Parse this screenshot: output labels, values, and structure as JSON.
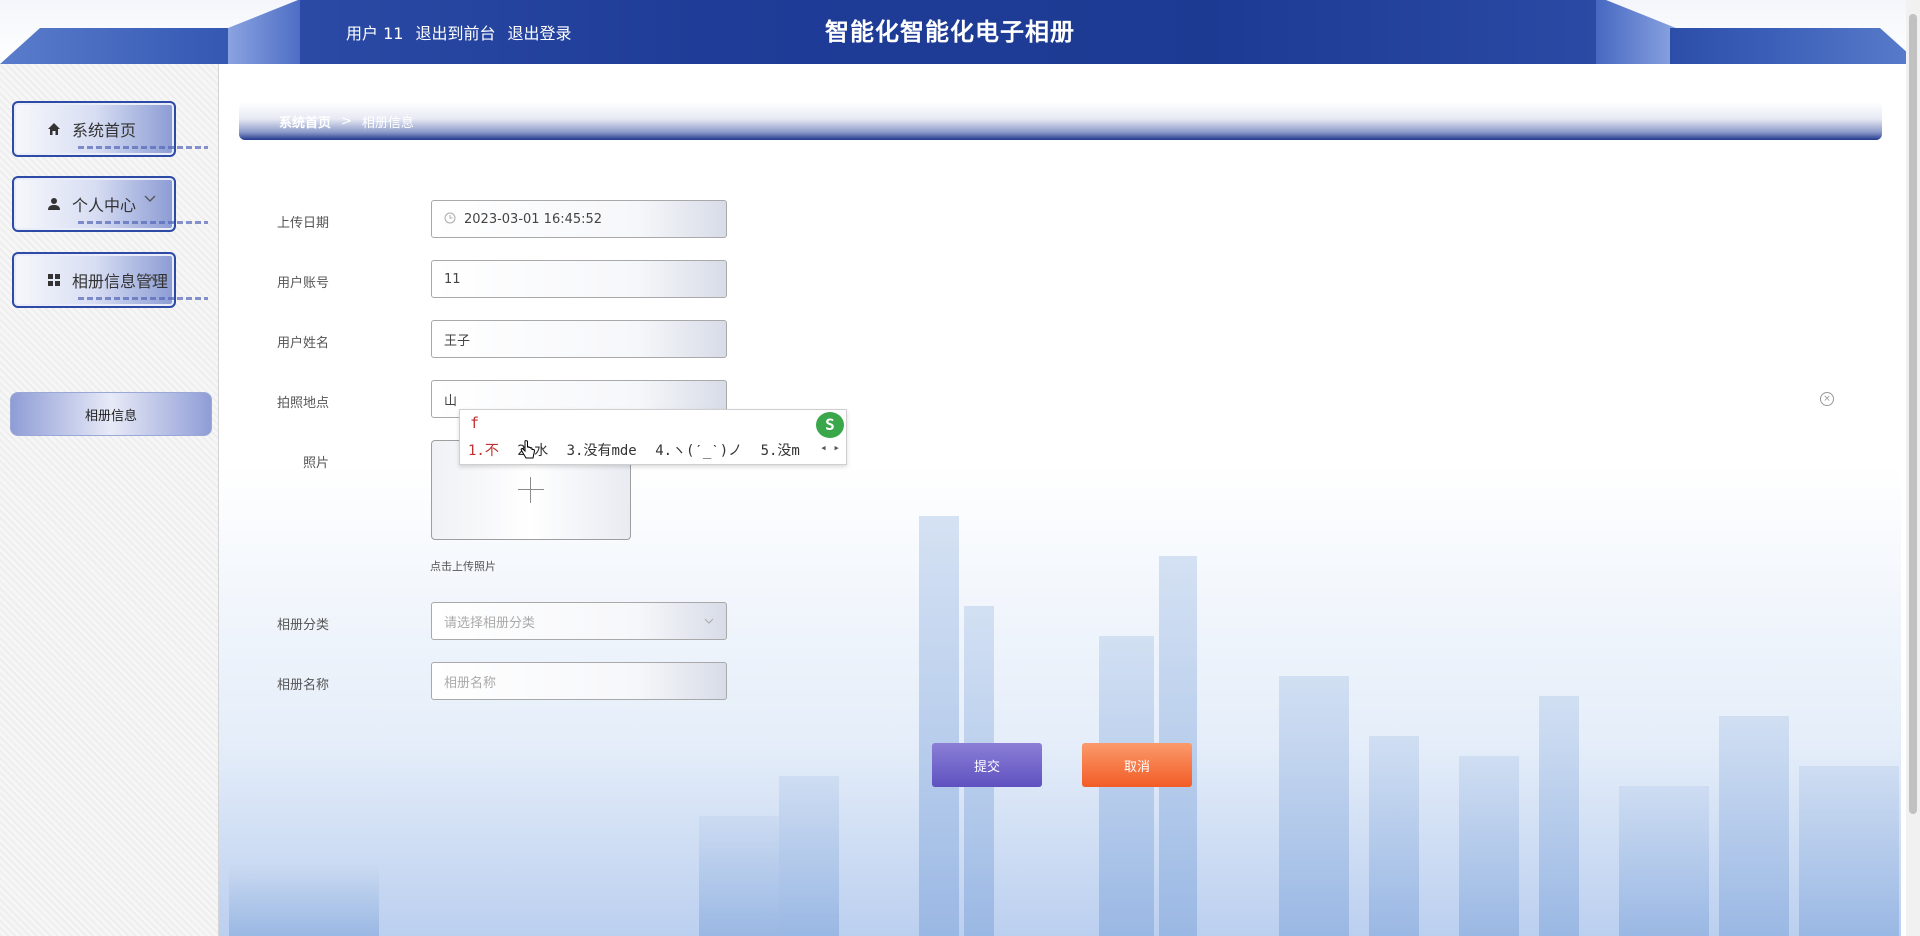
{
  "header": {
    "user_label": "用户 11",
    "link_front": "退出到前台",
    "link_logout": "退出登录",
    "app_title": "智能化智能化电子相册"
  },
  "sidebar": {
    "items": [
      {
        "label": "系统首页",
        "icon": "home-icon"
      },
      {
        "label": "个人中心",
        "icon": "user-icon",
        "chevron": "chevron-down-icon"
      },
      {
        "label": "相册信息管理",
        "icon": "grid-icon",
        "chevron": "chevron-up-icon"
      }
    ],
    "sub_item": "相册信息"
  },
  "breadcrumb": {
    "home": "系统首页",
    "sep": ">",
    "current": "相册信息"
  },
  "form": {
    "upload_date": {
      "label": "上传日期",
      "value": "2023-03-01 16:45:52"
    },
    "account": {
      "label": "用户账号",
      "value": "11"
    },
    "name": {
      "label": "用户姓名",
      "value": "王子"
    },
    "location": {
      "label": "拍照地点",
      "value": "山"
    },
    "photo": {
      "label": "照片",
      "hint": "点击上传照片"
    },
    "category": {
      "label": "相册分类",
      "placeholder": "请选择相册分类"
    },
    "album_name": {
      "label": "相册名称",
      "placeholder": "相册名称"
    }
  },
  "buttons": {
    "submit": "提交",
    "cancel": "取消"
  },
  "ime": {
    "composition": "f",
    "candidates": [
      "1.不",
      "2.水",
      "3.没有mde",
      "4.ヽ(ˊ_ˋ)ノ",
      "5.没m"
    ],
    "brand": "S"
  },
  "colors": {
    "header_blue": "#1f3d98",
    "submit": "#5f51c0",
    "cancel": "#f25c26"
  }
}
